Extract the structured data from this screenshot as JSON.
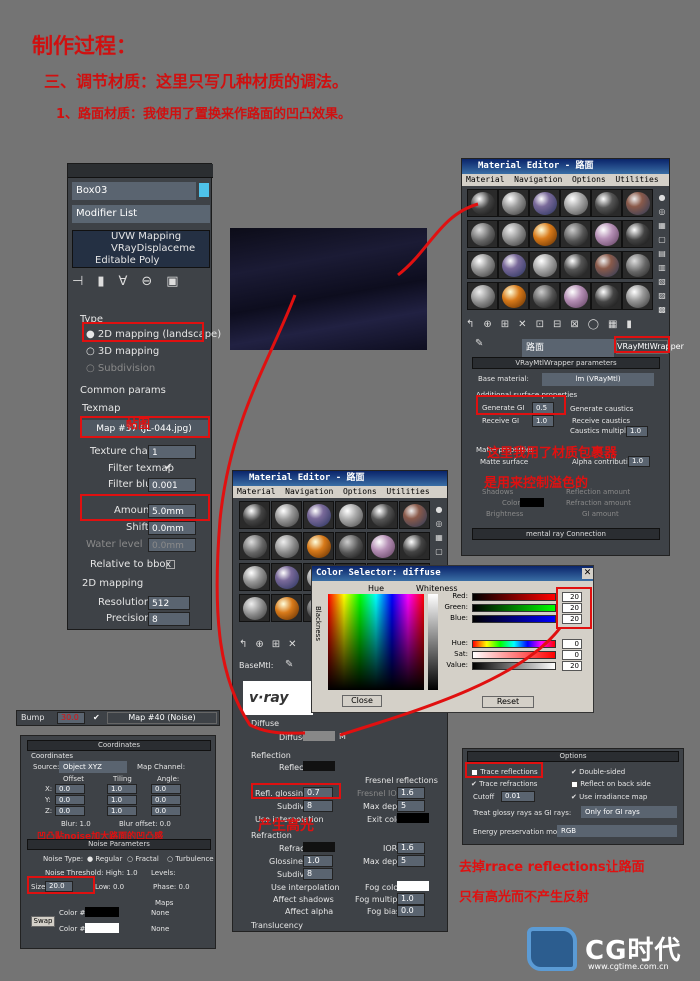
{
  "heading": {
    "title": "制作过程：",
    "section": "三、调节材质：这里只写几种材质的调法。",
    "item": "1、路面材质：我使用了置换来作路面的凹凸效果。"
  },
  "modifier_panel": {
    "object_name": "Box03",
    "modifier_list": "Modifier List",
    "stack": [
      "UVW Mapping",
      "VRayDisplaceme",
      "Editable Poly"
    ],
    "type_label": "Type",
    "options": [
      "2D mapping (landscape)",
      "3D mapping",
      "Subdivision"
    ],
    "common_params": "Common params",
    "texmap_label": "Texmap",
    "texmap_value": "Map #37 (JL-044.jpg)",
    "rows": [
      {
        "label": "Texture chan",
        "value": "1"
      },
      {
        "label": "Filter texmap",
        "value": "✔"
      },
      {
        "label": "Filter blur",
        "value": "0.001"
      },
      {
        "label": "Amount",
        "value": "5.0mm"
      },
      {
        "label": "Shift",
        "value": "0.0mm"
      },
      {
        "label": "Water level",
        "value": "0.0mm"
      },
      {
        "label": "Relative to bbox",
        "value": ""
      }
    ],
    "mapping2d": "2D mapping",
    "resolution_label": "Resolution",
    "resolution": "512",
    "precision_label": "Precision",
    "precision": "8",
    "annotation": "帖图"
  },
  "bump_row": {
    "label": "Bump",
    "value": "30.0",
    "map": "Map #40 (Noise)"
  },
  "noise_panel": {
    "coordinates": "Coordinates",
    "source_label": "Source:",
    "source": "Object XYZ",
    "map_channel": "Map Channel:",
    "offset": "Offset",
    "tiling": "Tiling",
    "angle": "Angle:",
    "axes": [
      "X:",
      "Y:",
      "Z:"
    ],
    "offset_vals": [
      "0.0",
      "0.0",
      "0.0"
    ],
    "tiling_vals": [
      "1.0",
      "1.0",
      "1.0"
    ],
    "angle_vals": [
      "0.0",
      "0.0",
      "0.0"
    ],
    "blur": "Blur: 1.0",
    "blur_offset": "Blur offset: 0.0",
    "annotation": "凹凸贴noise加大路面的凹凸感",
    "noise_params": "Noise Parameters",
    "noise_type": "Noise Type:",
    "types": [
      "Regular",
      "Fractal",
      "Turbulence"
    ],
    "threshold": "Noise Threshold: High: 1.0",
    "levels": "Levels:",
    "size_label": "Size",
    "size": "20.0",
    "low": "Low: 0.0",
    "phase": "Phase: 0.0",
    "maps": "Maps",
    "swap": "Swap",
    "color1": "Color #1",
    "color2": "Color #2",
    "none": "None"
  },
  "mat_editor_top": {
    "title": "Material Editor - 路面",
    "menu": [
      "Material",
      "Navigation",
      "Options",
      "Utilities"
    ],
    "mat_name": "路面",
    "mat_type": "VRayMtlWrapper",
    "params_title": "VRayMtlWrapper parameters",
    "base_label": "Base material:",
    "base_value": "lm (VRayMtl)",
    "additional": "Additional surface properties",
    "gen_gi": "Generate GI",
    "gen_gi_val": "0.5",
    "recv_gi": "Receive GI",
    "recv_gi_val": "1.0",
    "gen_caustics": "Generate caustics",
    "recv_caustics": "Receive caustics",
    "caustics_mult": "Caustics multiplier",
    "caustics_val": "1.0",
    "matte_props": "Matte properties",
    "matte_surface": "Matte surface",
    "alpha_contrib": "Alpha contribution",
    "alpha_val": "1.0",
    "shadows": "Shadows",
    "affect_alpha": "Affect alpha",
    "color": "Color",
    "brightness": "Brightness",
    "refl_amount": "Reflection amount",
    "refr_amount": "Refraction amount",
    "gi_amount": "GI amount",
    "mental_ray": "mental ray Connection",
    "annotation1": "这里我用了材质包裹器",
    "annotation2": "是用来控制溢色的"
  },
  "mat_editor_bottom": {
    "title": "Material Editor - 路面",
    "menu": [
      "Material",
      "Navigation",
      "Options",
      "Utilities"
    ],
    "base_label": "BaseMtl:",
    "diffuse_section": "Diffuse",
    "diffuse": "Diffuse",
    "m": "M",
    "reflection": "Reflection",
    "reflect": "Reflect",
    "refl_gloss": "Refl. glossiness",
    "refl_gloss_val": "0.7",
    "subdivs": "Subdivs",
    "subdivs_val": "8",
    "use_interp": "Use interpolation",
    "fresnel": "Fresnel reflections",
    "fresnel_ior": "Fresnel IOR",
    "fresnel_val": "1.6",
    "max_depth": "Max depth",
    "max_depth_val": "5",
    "exit_color": "Exit color",
    "refraction": "Refraction",
    "refract": "Refract",
    "ior": "IOR",
    "ior_val": "1.6",
    "gloss": "Glossiness",
    "gloss_val": "1.0",
    "max_depth2_val": "5",
    "subdivs2_val": "8",
    "use_interp2": "Use interpolation",
    "affect_shadows": "Affect shadows",
    "affect_alpha": "Affect alpha",
    "fog_color": "Fog color",
    "fog_mult": "Fog multiplier",
    "fog_mult_val": "1.0",
    "fog_bias": "Fog bias",
    "fog_bias_val": "0.0",
    "translucency": "Translucency",
    "annotation": "产生高光"
  },
  "color_selector": {
    "title": "Color Selector: diffuse",
    "hue": "Hue",
    "whiteness": "Whiteness",
    "blackness": "Blackness",
    "channels": [
      {
        "label": "Red:",
        "value": "20"
      },
      {
        "label": "Green:",
        "value": "20"
      },
      {
        "label": "Blue:",
        "value": "20"
      },
      {
        "label": "Hue:",
        "value": "0"
      },
      {
        "label": "Sat:",
        "value": "0"
      },
      {
        "label": "Value:",
        "value": "20"
      }
    ],
    "close": "Close",
    "reset": "Reset"
  },
  "options_panel": {
    "title": "Options",
    "trace_refl": "Trace reflections",
    "double_sided": "Double-sided",
    "trace_refr": "Trace refractions",
    "reflect_back": "Reflect on back side",
    "cutoff": "Cutoff",
    "cutoff_val": "0.01",
    "use_irr": "Use irradiance map",
    "glossy_gi": "Treat glossy rays as GI rays:",
    "glossy_gi_val": "Only for GI rays",
    "energy": "Energy preservation mode:",
    "energy_val": "RGB"
  },
  "annotation_bottom": [
    "去掉rrace reflections让路面",
    "只有高光而不产生反射"
  ],
  "logo": {
    "brand": "CG时代",
    "url": "www.cgtime.com.cn"
  },
  "colors": {
    "red": "#e01010",
    "panel": "#3b3f44",
    "field": "#5a6470"
  }
}
